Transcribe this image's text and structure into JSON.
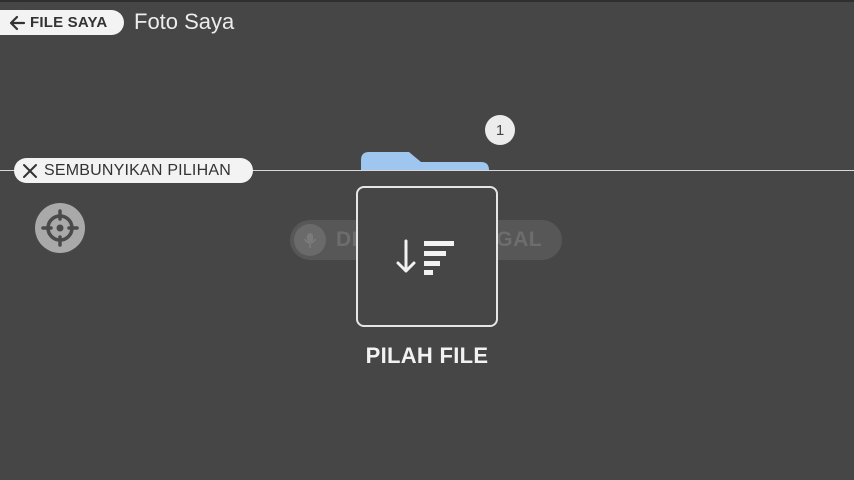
{
  "header": {
    "back_label": "FILE SAYA",
    "title": "Foto Saya"
  },
  "folder": {
    "badge_count": "1",
    "color": "#9ec6ee"
  },
  "options": {
    "hide_label": "SEMBUNYIKAN PILIHAN"
  },
  "search": {
    "ghost_label": "DENGAN TANGGAL"
  },
  "sort": {
    "label": "PILAH FILE"
  },
  "icons": {
    "back": "arrow-left-icon",
    "close": "close-icon",
    "target": "crosshair-icon",
    "mic": "mic-icon",
    "sort": "sort-descending-icon"
  }
}
